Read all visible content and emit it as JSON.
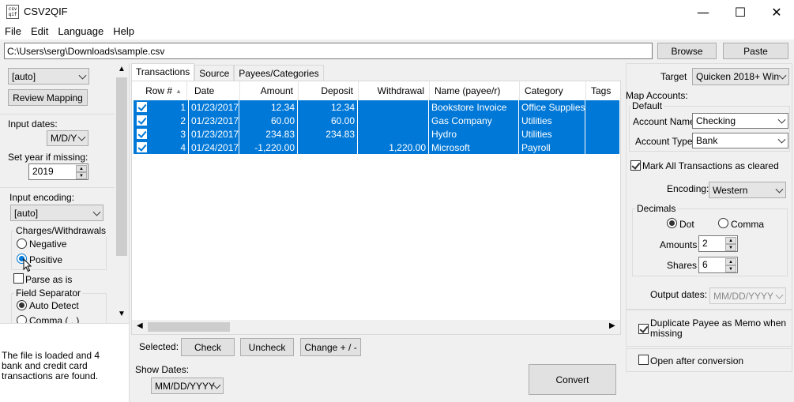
{
  "window": {
    "title": "CSV2QIF",
    "icon_text_top": "csv",
    "icon_text_bottom": "qif",
    "minimize": "—",
    "maximize": "☐",
    "close": "✕"
  },
  "menu": [
    "File",
    "Edit",
    "Language",
    "Help"
  ],
  "file": {
    "path": "C:\\Users\\serg\\Downloads\\sample.csv",
    "browse": "Browse",
    "paste": "Paste"
  },
  "left": {
    "mapping_select": "[auto]",
    "review_mapping": "Review Mapping",
    "input_dates_label": "Input dates:",
    "date_format": "M/D/Y",
    "set_year_label": "Set year if missing:",
    "year": "2019",
    "encoding_label": "Input encoding:",
    "encoding": "[auto]",
    "charges_title": "Charges/Withdrawals",
    "negative": "Negative",
    "positive": "Positive",
    "parse_as_is": "Parse as is",
    "field_sep_title": "Field Separator",
    "auto_detect": "Auto Detect",
    "comma": "Comma ( , )",
    "status": "The file is loaded and 4 bank and credit card transactions are found."
  },
  "tabs": [
    "Transactions",
    "Source",
    "Payees/Categories"
  ],
  "grid": {
    "columns": [
      "Row #",
      "Date",
      "Amount",
      "Deposit",
      "Withdrawal",
      "Name (payee/r)",
      "Category",
      "Tags"
    ],
    "rows": [
      {
        "row": "1",
        "date": "01/23/2017",
        "amount": "12.34",
        "deposit": "12.34",
        "withdrawal": "",
        "name": "Bookstore Invoice",
        "category": "Office Supplies",
        "tags": ""
      },
      {
        "row": "2",
        "date": "01/23/2017",
        "amount": "60.00",
        "deposit": "60.00",
        "withdrawal": "",
        "name": "Gas Company",
        "category": "Utilities",
        "tags": ""
      },
      {
        "row": "3",
        "date": "01/23/2017",
        "amount": "234.83",
        "deposit": "234.83",
        "withdrawal": "",
        "name": "Hydro",
        "category": "Utilities",
        "tags": ""
      },
      {
        "row": "4",
        "date": "01/24/2017",
        "amount": "-1,220.00",
        "deposit": "",
        "withdrawal": "1,220.00",
        "name": "Microsoft",
        "category": "Payroll",
        "tags": ""
      }
    ]
  },
  "bottom": {
    "selected_label": "Selected:",
    "check": "Check",
    "uncheck": "Uncheck",
    "change_sign": "Change + / -",
    "show_dates_label": "Show Dates:",
    "show_dates": "MM/DD/YYYY",
    "convert": "Convert"
  },
  "right": {
    "target_label": "Target",
    "target": "Quicken 2018+ Win",
    "map_accounts": "Map Accounts:",
    "default_group": "Default",
    "account_name_label": "Account Name:",
    "account_name": "Checking",
    "account_type_label": "Account Type:",
    "account_type": "Bank",
    "mark_all": "Mark All Transactions as cleared",
    "encoding_label": "Encoding:",
    "encoding": "Western",
    "decimals_title": "Decimals",
    "dot": "Dot",
    "comma": "Comma",
    "amounts_label": "Amounts",
    "amounts": "2",
    "shares_label": "Shares",
    "shares": "6",
    "output_dates_label": "Output dates:",
    "output_dates": "MM/DD/YYYY",
    "duplicate_payee": "Duplicate Payee as Memo when missing",
    "open_after": "Open after conversion"
  },
  "colors": {
    "selection": "#0078d7",
    "accent": "#0078d7"
  }
}
